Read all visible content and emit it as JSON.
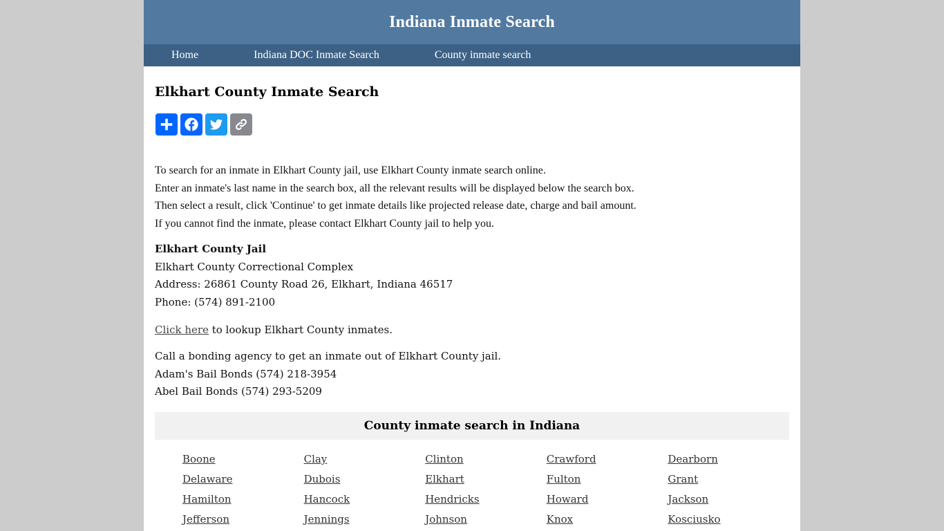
{
  "header": {
    "site_title": "Indiana Inmate Search"
  },
  "nav": {
    "items": [
      {
        "label": "Home"
      },
      {
        "label": "Indiana DOC Inmate Search"
      },
      {
        "label": "County inmate search"
      }
    ]
  },
  "main": {
    "page_title": "Elkhart County Inmate Search",
    "share": {
      "buttons": [
        {
          "icon": "plus-icon",
          "label": "Share",
          "color": "#0166ff"
        },
        {
          "icon": "facebook-icon",
          "label": "Facebook",
          "color": "#0866ff"
        },
        {
          "icon": "twitter-icon",
          "label": "Twitter",
          "color": "#1d9bf0"
        },
        {
          "icon": "link-icon",
          "label": "Copy Link",
          "color": "#888990"
        }
      ]
    },
    "intro_lines": [
      "To search for an inmate in Elkhart County jail, use Elkhart County inmate search online.",
      "Enter an inmate's last name in the search box, all the relevant results will be displayed below the search box.",
      "Then select a result, click 'Continue' to get inmate details like projected release date, charge and bail amount.",
      "If you cannot find the inmate, please contact Elkhart County jail to help you."
    ],
    "jail": {
      "name": "Elkhart County Jail",
      "facility": "Elkhart County Correctional Complex",
      "address": "Address: 26861 County Road 26, Elkhart, Indiana 46517",
      "phone": "Phone: (574) 891-2100"
    },
    "lookup": {
      "link_text": "Click here",
      "rest_text": " to lookup Elkhart County inmates."
    },
    "bonds": {
      "intro": "Call a bonding agency to get an inmate out of Elkhart County jail.",
      "agencies": [
        "Adam's Bail Bonds (574) 218-3954",
        "Abel Bail Bonds (574) 293-5209"
      ]
    },
    "county_section": {
      "heading": "County inmate search in Indiana",
      "counties": [
        "Boone",
        "Clay",
        "Clinton",
        "Crawford",
        "Dearborn",
        "Delaware",
        "Dubois",
        "Elkhart",
        "Fulton",
        "Grant",
        "Hamilton",
        "Hancock",
        "Hendricks",
        "Howard",
        "Jackson",
        "Jefferson",
        "Jennings",
        "Johnson",
        "Knox",
        "Kosciusko"
      ]
    }
  },
  "colors": {
    "page_background": "#cccccc",
    "header_background": "#527aa0",
    "nav_background": "#3d6185",
    "section_heading_background": "#f1f1f1"
  }
}
